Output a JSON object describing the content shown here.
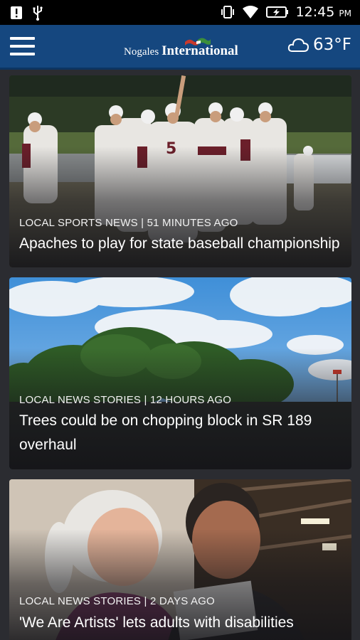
{
  "status_bar": {
    "time": "12:45",
    "ampm": "PM",
    "icons": [
      "alert-icon",
      "usb-icon",
      "vibrate-icon",
      "wifi-icon",
      "battery-charging-icon"
    ]
  },
  "app_bar": {
    "menu_icon": "hamburger-menu-icon",
    "logo_part1": "Nogales",
    "logo_part2": "International",
    "weather_icon": "cloud-icon",
    "temperature": "63°F",
    "colors": {
      "bar": "#15477f"
    }
  },
  "stories": [
    {
      "category_time": "LOCAL SPORTS NEWS | 51 MINUTES AGO",
      "headline": "Apaches to play for state baseball championship",
      "image": "baseball-team-celebration-photo"
    },
    {
      "category_time": "LOCAL NEWS STORIES | 12 HOURS AGO",
      "headline": "Trees could be on chopping block in SR 189 overhaul",
      "image": "trees-and-sky-photo"
    },
    {
      "category_time": "LOCAL NEWS STORIES | 2 DAYS AGO",
      "headline": "'We Are Artists' lets adults with disabilities",
      "image": "two-women-artists-photo"
    }
  ]
}
